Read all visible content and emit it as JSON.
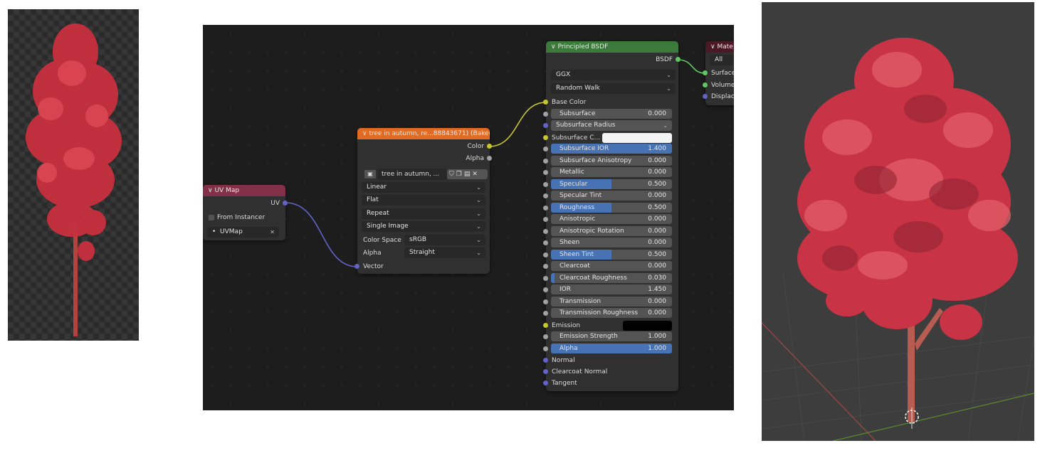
{
  "uvmap_node": {
    "title": "UV Map",
    "output_uv": "UV",
    "from_instancer": "From Instancer",
    "uvmap_value": "UVMap"
  },
  "image_node": {
    "title": "tree in autumn, re...88843671) (Baked)",
    "output_color": "Color",
    "output_alpha": "Alpha",
    "image_name": "tree in autumn, ...",
    "interpolation": "Linear",
    "projection": "Flat",
    "extension": "Repeat",
    "source": "Single Image",
    "color_space_label": "Color Space",
    "color_space_value": "sRGB",
    "alpha_label": "Alpha",
    "alpha_value": "Straight",
    "input_vector": "Vector"
  },
  "bsdf_node": {
    "title": "Principled BSDF",
    "output": "BSDF",
    "distribution": "GGX",
    "subsurface_method": "Random Walk",
    "base_color": "Base Color",
    "subsurface": {
      "label": "Subsurface",
      "value": "0.000",
      "fill": 0
    },
    "subsurface_radius": "Subsurface Radius",
    "subsurface_color": "Subsurface C...",
    "subsurface_ior": {
      "label": "Subsurface IOR",
      "value": "1.400",
      "fill": 1.0
    },
    "subsurface_anisotropy": {
      "label": "Subsurface Anisotropy",
      "value": "0.000",
      "fill": 0
    },
    "metallic": {
      "label": "Metallic",
      "value": "0.000",
      "fill": 0
    },
    "specular": {
      "label": "Specular",
      "value": "0.500",
      "fill": 0.5
    },
    "specular_tint": {
      "label": "Specular Tint",
      "value": "0.000",
      "fill": 0
    },
    "roughness": {
      "label": "Roughness",
      "value": "0.500",
      "fill": 0.5
    },
    "anisotropic": {
      "label": "Anisotropic",
      "value": "0.000",
      "fill": 0
    },
    "anisotropic_rotation": {
      "label": "Anisotropic Rotation",
      "value": "0.000",
      "fill": 0
    },
    "sheen": {
      "label": "Sheen",
      "value": "0.000",
      "fill": 0
    },
    "sheen_tint": {
      "label": "Sheen Tint",
      "value": "0.500",
      "fill": 0.5
    },
    "clearcoat": {
      "label": "Clearcoat",
      "value": "0.000",
      "fill": 0
    },
    "clearcoat_roughness": {
      "label": "Clearcoat Roughness",
      "value": "0.030",
      "fill": 0.03
    },
    "ior": {
      "label": "IOR",
      "value": "1.450",
      "fill": 0
    },
    "transmission": {
      "label": "Transmission",
      "value": "0.000",
      "fill": 0
    },
    "transmission_roughness": {
      "label": "Transmission Roughness",
      "value": "0.000",
      "fill": 0
    },
    "emission": "Emission",
    "emission_strength": {
      "label": "Emission Strength",
      "value": "1.000",
      "fill": 0
    },
    "alpha": {
      "label": "Alpha",
      "value": "1.000",
      "fill": 1.0
    },
    "normal": "Normal",
    "clearcoat_normal": "Clearcoat Normal",
    "tangent": "Tangent"
  },
  "output_node": {
    "title": "Mate",
    "target": "All",
    "surface": "Surface",
    "volume": "Volume",
    "displacement": "Displace"
  },
  "colors": {
    "uvmap_header": "#83314a",
    "image_header": "#e06b25",
    "bsdf_header": "#3b7a3b",
    "output_header": "#4a1826",
    "accent_blue": "#4772b3",
    "foliage_red": "#d43a48"
  }
}
